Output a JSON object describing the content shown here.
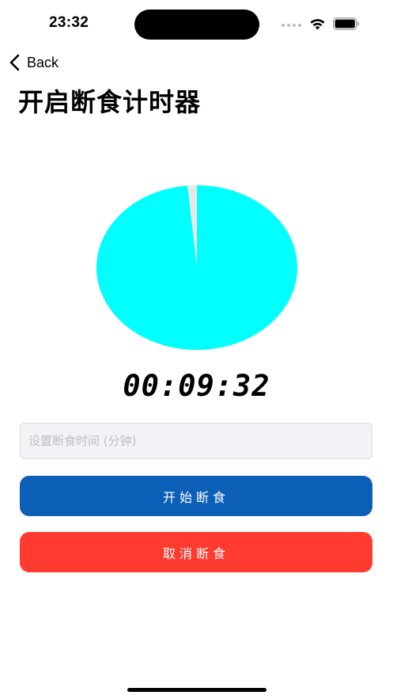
{
  "status_bar": {
    "time": "23:32",
    "wifi_icon": "wifi-icon",
    "battery_icon": "battery-icon"
  },
  "nav": {
    "back_label": "Back",
    "back_icon": "chevron-left-icon"
  },
  "page": {
    "title": "开启断食计时器"
  },
  "progress_pie": {
    "elapsed_fraction": 0.985,
    "fill_color": "#00ffff",
    "remaining_color": "#e8e8e8"
  },
  "timer": {
    "display": "00:09:32"
  },
  "duration_input": {
    "value": "",
    "placeholder": "设置断食时间 (分钟)"
  },
  "buttons": {
    "start_label": "开始断食",
    "start_color": "#0c5fb6",
    "cancel_label": "取消断食",
    "cancel_color": "#ff3b30"
  }
}
